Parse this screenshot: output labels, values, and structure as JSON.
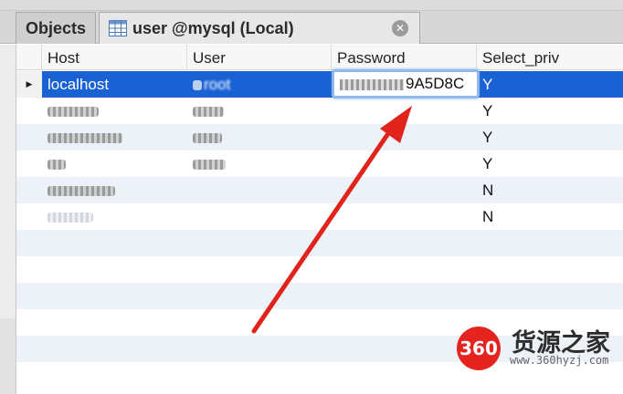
{
  "tabs": {
    "objects_label": "Objects",
    "table_tab_label": "user @mysql (Local)",
    "close_symbol": "✕"
  },
  "grid": {
    "columns": [
      "Host",
      "User",
      "Password",
      "Select_priv"
    ],
    "rows": [
      {
        "host": "localhost",
        "user": "root",
        "password": "9A5D8C",
        "select_priv": "Y",
        "selected": true
      },
      {
        "host": "",
        "user": "",
        "password": "",
        "select_priv": "Y"
      },
      {
        "host": "",
        "user": "",
        "password": "",
        "select_priv": "Y"
      },
      {
        "host": "",
        "user": "",
        "password": "",
        "select_priv": "Y"
      },
      {
        "host": "",
        "user": "",
        "password": "",
        "select_priv": "N"
      },
      {
        "host": "",
        "user": "",
        "password": "",
        "select_priv": "N"
      }
    ],
    "row_indicator": "▶"
  },
  "watermark": {
    "badge": "360",
    "name": "货源之家",
    "url": "www.360hyzj.com"
  },
  "colors": {
    "selection": "#1a62d4",
    "arrow": "#e0231b",
    "alt_row": "#edf1f8"
  }
}
